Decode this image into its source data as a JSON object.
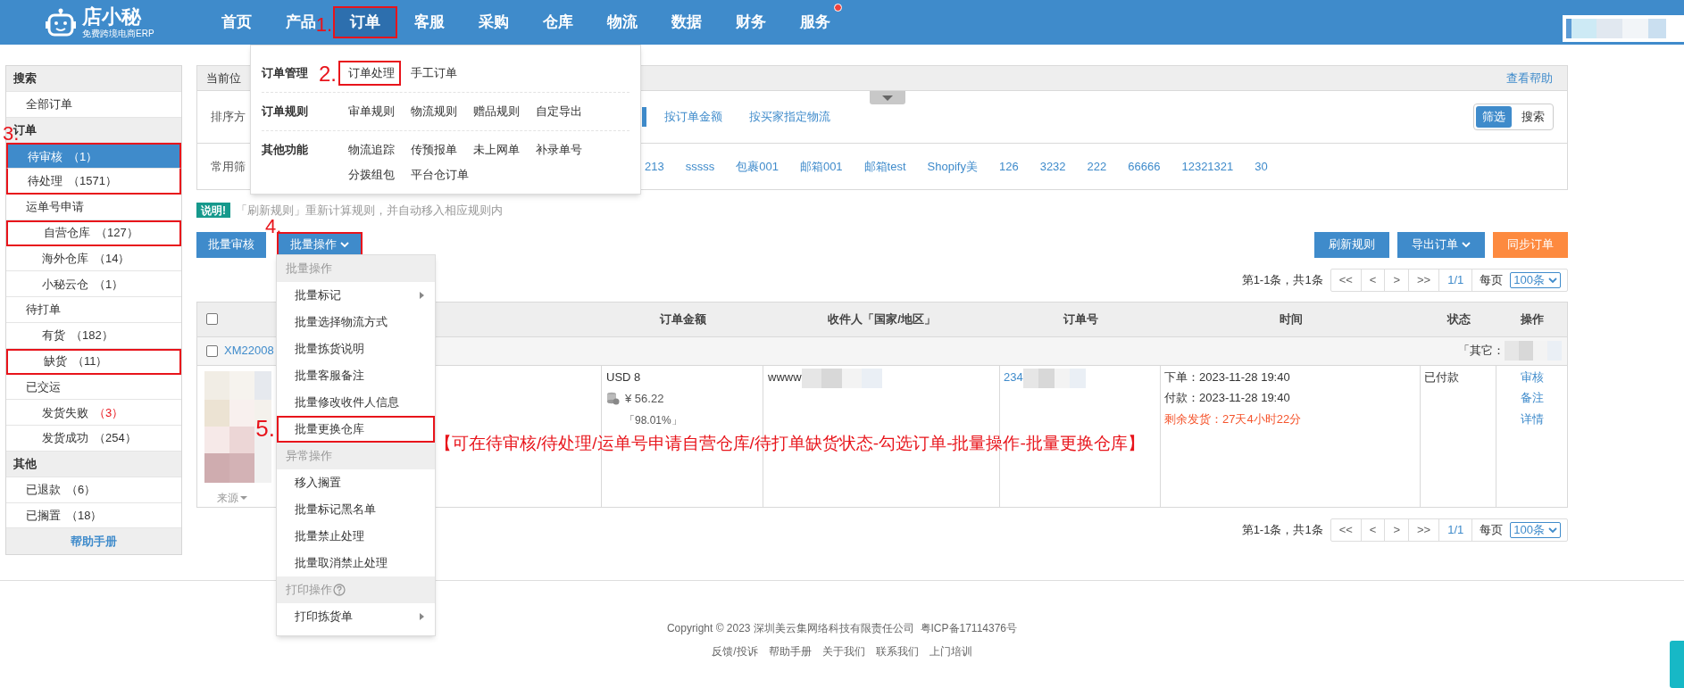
{
  "header": {
    "logo_name": "店小秘",
    "logo_tagline": "免费跨境电商ERP",
    "nav": [
      {
        "label": "首页",
        "selected": false,
        "marked": false,
        "notification": false
      },
      {
        "label": "产品",
        "selected": false,
        "marked": false,
        "notification": false
      },
      {
        "label": "订单",
        "selected": true,
        "marked": true,
        "step": "1.",
        "notification": false
      },
      {
        "label": "客服",
        "selected": false,
        "marked": false,
        "notification": false
      },
      {
        "label": "采购",
        "selected": false,
        "marked": false,
        "notification": false
      },
      {
        "label": "仓库",
        "selected": false,
        "marked": false,
        "notification": false
      },
      {
        "label": "物流",
        "selected": false,
        "marked": false,
        "notification": false
      },
      {
        "label": "数据",
        "selected": false,
        "marked": false,
        "notification": false
      },
      {
        "label": "财务",
        "selected": false,
        "marked": false,
        "notification": false
      },
      {
        "label": "服务",
        "selected": false,
        "marked": false,
        "notification": true
      }
    ]
  },
  "order_menu": {
    "groups": [
      {
        "title": "订单管理",
        "items": [
          {
            "label": "订单处理",
            "marked": true,
            "step": "2."
          },
          {
            "label": "手工订单",
            "marked": false
          }
        ]
      },
      {
        "title": "订单规则",
        "items": [
          {
            "label": "审单规则",
            "marked": false
          },
          {
            "label": "物流规则",
            "marked": false
          },
          {
            "label": "赠品规则",
            "marked": false
          },
          {
            "label": "自定导出",
            "marked": false
          }
        ]
      },
      {
        "title": "其他功能",
        "items": [
          {
            "label": "物流追踪",
            "marked": false
          },
          {
            "label": "传预报单",
            "marked": false
          },
          {
            "label": "未上网单",
            "marked": false
          },
          {
            "label": "补录单号",
            "marked": false
          },
          {
            "label": "分拨组包",
            "marked": false
          },
          {
            "label": "平台仓订单",
            "marked": false
          }
        ]
      }
    ]
  },
  "sidebar": {
    "sections": [
      {
        "title": "搜索",
        "items": [
          {
            "label": "全部订单",
            "selected": false,
            "marked": false
          }
        ]
      },
      {
        "title": "订单",
        "items": [
          {
            "label": "待审核",
            "count": "（1）",
            "alert": false,
            "selected": true,
            "marked": true,
            "step": "3."
          },
          {
            "label": "待处理",
            "count": "（1571）",
            "alert": false,
            "selected": false,
            "marked": true
          },
          {
            "label": "运单号申请",
            "selected": false,
            "marked": false,
            "children": [
              {
                "label": "自营仓库",
                "count": "（127）",
                "alert": false,
                "selected": false,
                "marked": true
              },
              {
                "label": "海外仓库",
                "count": "（14）",
                "alert": false,
                "selected": false,
                "marked": false
              },
              {
                "label": "小秘云仓",
                "count": "（1）",
                "alert": false,
                "selected": false,
                "marked": false
              }
            ]
          },
          {
            "label": "待打单",
            "selected": false,
            "marked": false,
            "children": [
              {
                "label": "有货",
                "count": "（182）",
                "alert": false,
                "selected": false,
                "marked": false
              },
              {
                "label": "缺货",
                "count": "（11）",
                "alert": false,
                "selected": false,
                "marked": true
              }
            ]
          },
          {
            "label": "已交运",
            "selected": false,
            "marked": false,
            "children": [
              {
                "label": "发货失败",
                "count": "（3）",
                "alert": true,
                "selected": false,
                "marked": false
              },
              {
                "label": "发货成功",
                "count": "（254）",
                "alert": false,
                "selected": false,
                "marked": false
              }
            ]
          }
        ]
      },
      {
        "title": "其他",
        "items": [
          {
            "label": "已退款",
            "count": "（6）",
            "alert": false,
            "selected": false,
            "marked": false
          },
          {
            "label": "已搁置",
            "count": "（18）",
            "alert": false,
            "selected": false,
            "marked": false
          }
        ]
      }
    ],
    "help": "帮助手册"
  },
  "breadcrumb": {
    "label": "当前位",
    "help_link": "查看帮助"
  },
  "filters": {
    "sort_label": "排序方",
    "sort_options": [
      "按订单金额",
      "按买家指定物流"
    ],
    "mode_toggle": [
      {
        "label": "筛选",
        "selected": true
      },
      {
        "label": "搜索",
        "selected": false
      }
    ],
    "quick_label": "常用筛",
    "quick_filters": [
      "213",
      "sssss",
      "包裹001",
      "邮箱001",
      "邮箱test",
      "Shopify美",
      "126",
      "3232",
      "222",
      "66666",
      "12321321",
      "30"
    ]
  },
  "notice": {
    "badge": "说明!",
    "text": "「刷新规则」重新计算规则，并自动移入相应规则内"
  },
  "actions": {
    "left": [
      {
        "label": "批量审核",
        "kind": "button",
        "color": "#3f8bcb",
        "marked": false
      },
      {
        "label": "批量操作",
        "kind": "dropdown",
        "color": "#3f8bcb",
        "marked": true,
        "step": "4."
      }
    ],
    "right": [
      {
        "label": "刷新规则",
        "kind": "button",
        "color": "#3f8bcb"
      },
      {
        "label": "导出订单",
        "kind": "dropdown",
        "color": "#3f8bcb"
      },
      {
        "label": "同步订单",
        "kind": "button",
        "color": "#fd8a3f"
      }
    ]
  },
  "pagination_top": {
    "summary": "第1-1条，共1条",
    "buttons": [
      "<<",
      "<",
      ">",
      ">>"
    ],
    "page": "1/1",
    "per_page_label": "每页",
    "per_page": "100条"
  },
  "table": {
    "header_checkbox": {
      "checked": false
    },
    "columns": [
      "订单金额",
      "收件人「国家/地区」",
      "订单号",
      "时间",
      "状态",
      "操作"
    ],
    "orders": [
      {
        "checked": false,
        "order_id": "XM22008",
        "other_label": "「其它：",
        "source": "来源",
        "amount": "USD 8",
        "cny": "¥ 56.22",
        "ratio": "「98.01%」",
        "recipient": "wwww",
        "order_no": "234",
        "times": [
          {
            "text": "下单：2023-11-28 19:40",
            "kind": "normal"
          },
          {
            "text": "付款：2023-11-28 19:40",
            "kind": "normal"
          },
          {
            "text": "剩余发货：27天4小时22分",
            "kind": "warning"
          }
        ],
        "status": "已付款",
        "operations": [
          "审核",
          "备注",
          "详情"
        ]
      }
    ]
  },
  "pagination_bottom": {
    "summary": "第1-1条，共1条",
    "buttons": [
      "<<",
      "<",
      ">",
      ">>"
    ],
    "page": "1/1",
    "per_page_label": "每页",
    "per_page": "100条"
  },
  "batch_menu": {
    "sections": [
      {
        "title": "批量操作",
        "help": false,
        "items": [
          {
            "label": "批量标记",
            "submenu": true,
            "marked": false
          },
          {
            "label": "批量选择物流方式",
            "submenu": false,
            "marked": false
          },
          {
            "label": "批量拣货说明",
            "submenu": false,
            "marked": false
          },
          {
            "label": "批量客服备注",
            "submenu": false,
            "marked": false
          },
          {
            "label": "批量修改收件人信息",
            "submenu": false,
            "marked": false
          },
          {
            "label": "批量更换仓库",
            "submenu": false,
            "marked": true,
            "step": "5."
          }
        ]
      },
      {
        "title": "异常操作",
        "help": false,
        "items": [
          {
            "label": "移入搁置",
            "submenu": false,
            "marked": false
          },
          {
            "label": "批量标记黑名单",
            "submenu": false,
            "marked": false
          },
          {
            "label": "批量禁止处理",
            "submenu": false,
            "marked": false
          },
          {
            "label": "批量取消禁止处理",
            "submenu": false,
            "marked": false
          }
        ]
      },
      {
        "title": "打印操作",
        "help": true,
        "items": [
          {
            "label": "打印拣货单",
            "submenu": true,
            "marked": false
          }
        ]
      }
    ]
  },
  "annotation": "【可在待审核/待处理/运单号申请自营仓库/待打单缺货状态-勾选订单-批量操作-批量更换仓库】",
  "footer": {
    "copyright": "Copyright © 2023 深圳美云集网络科技有限责任公司  粤ICP备17114376号",
    "links": [
      "反馈/投诉",
      "帮助手册",
      "关于我们",
      "联系我们",
      "上门培训"
    ]
  }
}
